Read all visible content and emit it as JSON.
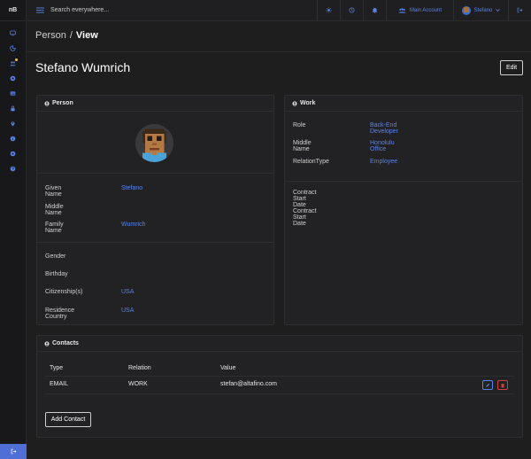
{
  "brand": "nB",
  "topbar": {
    "search_placeholder": "Search everywhere...",
    "account_label": "Main Account",
    "user_name": "Stefano"
  },
  "breadcrumb": {
    "parent": "Person",
    "separator": "/",
    "current": "View"
  },
  "person_name": "Stefano Wumrich",
  "edit_label": "Edit",
  "person_card": {
    "title": "Person",
    "fields": [
      {
        "label": "Given Name",
        "value": "Stefano"
      },
      {
        "label": "Middle Name",
        "value": ""
      },
      {
        "label": "Family Name",
        "value": "Wumrich"
      },
      {
        "label": "Gender",
        "value": ""
      },
      {
        "label": "Birthday",
        "value": ""
      },
      {
        "label": "Citizenship(s)",
        "value": "USA"
      },
      {
        "label": "Residence Country",
        "value": "USA"
      }
    ]
  },
  "work_card": {
    "title": "Work",
    "fields": [
      {
        "label": "Role",
        "value": "Back-End Developer"
      },
      {
        "label": "Middle Name",
        "value": "Honolulu Office"
      },
      {
        "label": "RelationType",
        "value": "Employee"
      },
      {
        "label": "Contract Start Date",
        "value": ""
      },
      {
        "label": "Contract Start Date",
        "value": ""
      }
    ]
  },
  "contacts_card": {
    "title": "Contacts",
    "columns": [
      "Type",
      "Relation",
      "Value"
    ],
    "rows": [
      {
        "type": "EMAIL",
        "relation": "WORK",
        "value": "stefan@altafino.com"
      }
    ],
    "add_label": "Add Contact"
  },
  "colors": {
    "accent": "#5b84e8",
    "background": "#1e1e1f",
    "card": "#222224",
    "danger": "#d04040"
  },
  "icons": [
    "monitor-icon",
    "pie-chart-icon",
    "users-icon",
    "support-icon",
    "list-icon",
    "lock-icon",
    "pin-icon",
    "info-icon",
    "gear-icon",
    "help-icon",
    "logout-icon",
    "menu-icon",
    "sun-icon",
    "clock-icon",
    "bell-icon",
    "team-icon",
    "chevron-down-icon",
    "pencil-icon",
    "trash-icon"
  ]
}
